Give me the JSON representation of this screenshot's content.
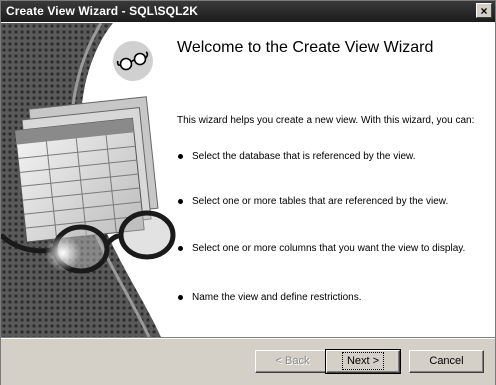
{
  "window": {
    "title": "Create View Wizard - SQL\\SQL2K",
    "close_label": "×"
  },
  "content": {
    "heading": "Welcome to the Create View Wizard",
    "intro": "This wizard helps you create a new view. With this wizard, you can:",
    "bullets": [
      "Select the database that is referenced by the view.",
      "Select one or more tables that are referenced by the view.",
      "Select one or more columns that you want the view to display.",
      "Name the view and define restrictions."
    ]
  },
  "buttons": {
    "back": "< Back",
    "next": "Next >",
    "cancel": "Cancel"
  },
  "icons": {
    "welcome": "glasses-icon",
    "sidebar_art": "spreadsheet-glasses-illustration"
  },
  "colors": {
    "titlebar": "#1c1c1c",
    "dialog_face": "#d4d0c8",
    "text": "#000000"
  }
}
